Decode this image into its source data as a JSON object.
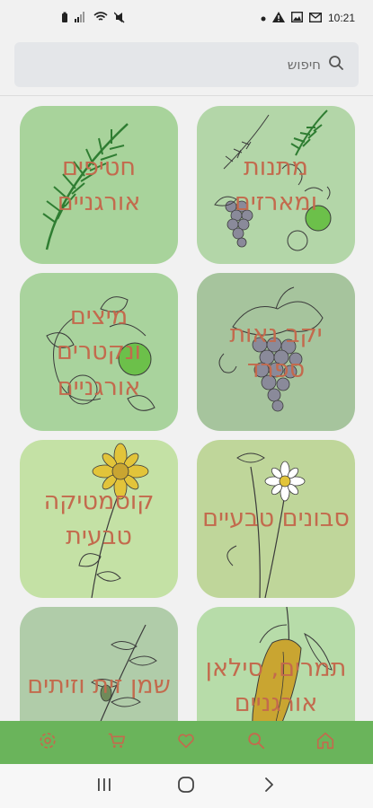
{
  "status_bar": {
    "time": "10:21",
    "left_icons": [
      "battery-icon",
      "signal-icon",
      "wifi-icon",
      "mute-icon"
    ],
    "right_icons": [
      "dot-icon",
      "warning-icon",
      "image-icon",
      "mail-icon"
    ]
  },
  "search": {
    "placeholder": "חיפוש",
    "icon": "search-icon"
  },
  "categories": [
    {
      "label": "מתנות ומארזים",
      "bg": "#b3d6a8"
    },
    {
      "label": "חטיפים אורגניים",
      "bg": "#a8d39b"
    },
    {
      "label": "יקב נאות ספרד",
      "bg": "#a6c49d"
    },
    {
      "label": "מיצים ונקטרים אורגניים",
      "bg": "#a9d39d"
    },
    {
      "label": "סבונים טבעיים",
      "bg": "#bfd69a"
    },
    {
      "label": "קוסמטיקה טבעית",
      "bg": "#c4e1a5"
    },
    {
      "label": "תמרים, סילאן אורגניים",
      "bg": "#b7dca9"
    },
    {
      "label": "שמן זית וזיתים",
      "bg": "#b0cca9"
    }
  ],
  "bottom_nav": {
    "bg": "#6ab45b",
    "icon_color": "#c36a4d",
    "items": [
      "home-icon",
      "search-icon",
      "heart-icon",
      "cart-icon",
      "settings-icon"
    ]
  },
  "system_nav": [
    "recents-icon",
    "home-circle-icon",
    "back-icon"
  ]
}
